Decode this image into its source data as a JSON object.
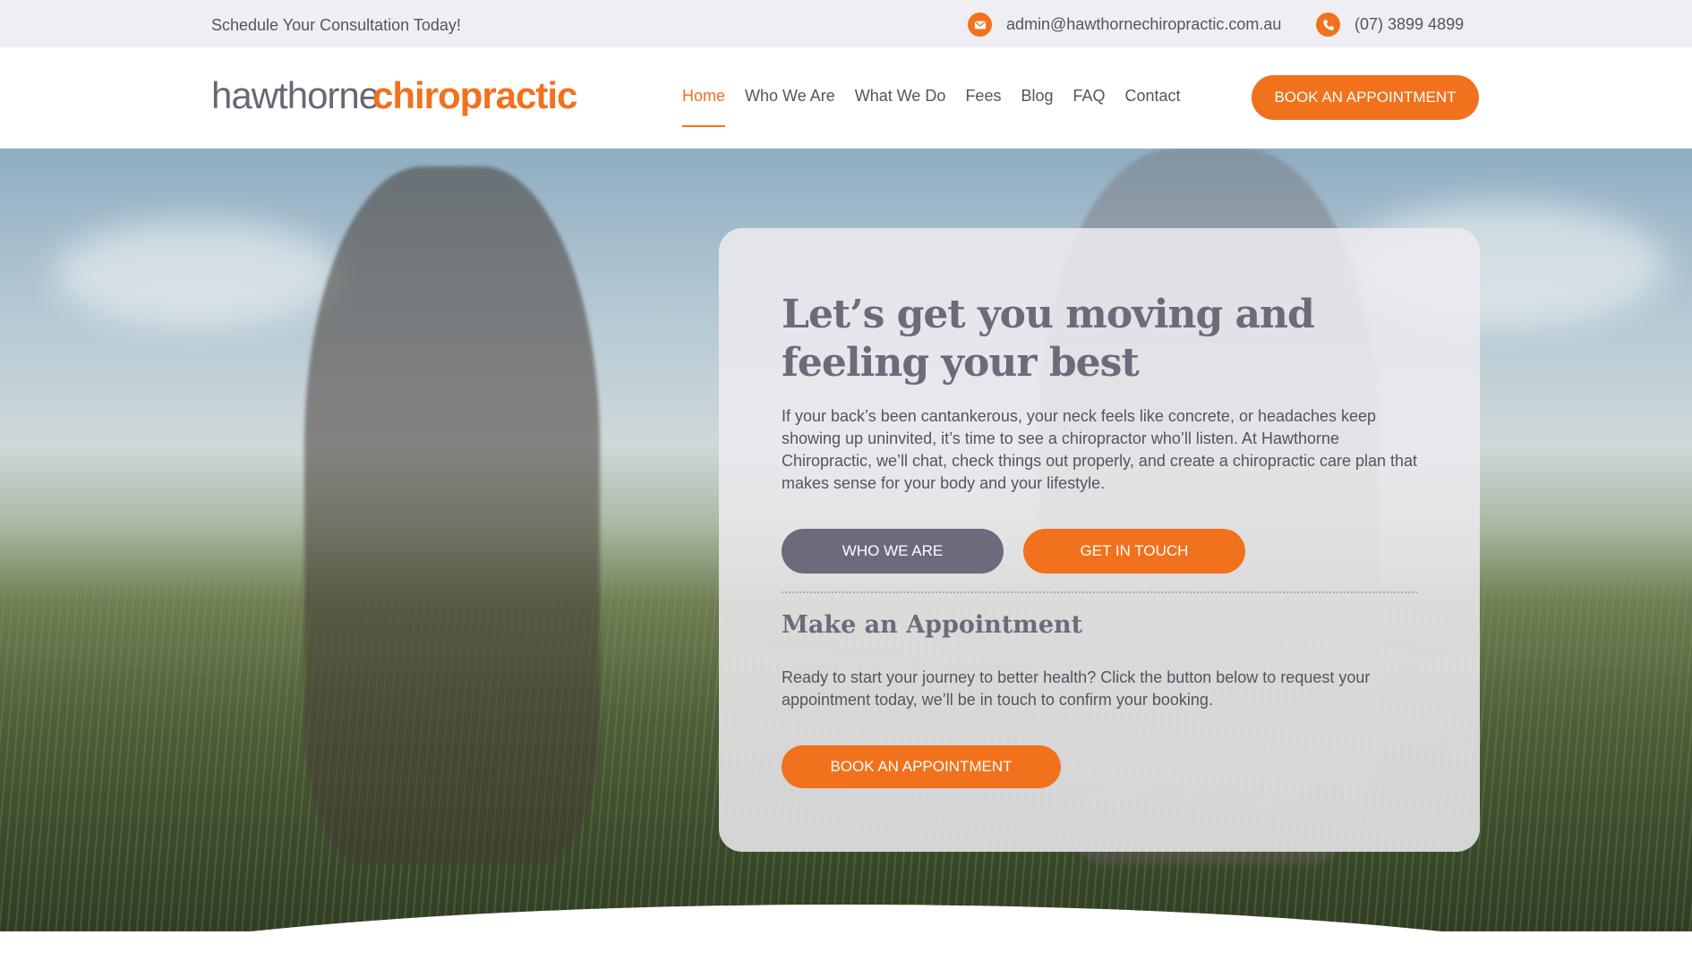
{
  "topbar": {
    "tagline": "Schedule Your Consultation Today!",
    "email": "admin@hawthornechiropractic.com.au",
    "phone": "(07) 3899 4899",
    "email_icon": "envelope-icon",
    "phone_icon": "phone-icon"
  },
  "logo": {
    "light": "hawthorne",
    "bold": "chiropractic"
  },
  "nav": {
    "items": [
      {
        "label": "Home",
        "active": true
      },
      {
        "label": "Who We Are"
      },
      {
        "label": "What We Do"
      },
      {
        "label": "Fees"
      },
      {
        "label": "Blog"
      },
      {
        "label": "FAQ"
      },
      {
        "label": "Contact"
      }
    ],
    "book_label": "BOOK AN APPOINTMENT"
  },
  "hero": {
    "title": "Let’s get you moving and feeling your best",
    "lead": "If your back’s been cantankerous, your neck feels like concrete, or headaches keep showing up uninvited, it’s time to see a chiropractor who’ll listen. At Hawthorne Chiropractic, we’ll chat, check things out properly, and create a chiropractic care plan that makes sense for your body and your lifestyle.",
    "who_label": "WHO WE ARE",
    "touch_label": "GET IN TOUCH",
    "appointment_title": "Make an Appointment",
    "appointment_text": "Ready to start your journey to better health? Click the button below to request your appointment today, we’ll be in touch to confirm your booking.",
    "book_label": "BOOK AN APPOINTMENT"
  },
  "colors": {
    "accent": "#f2711c",
    "secondary": "#6d6a7c",
    "topbar_bg": "#efeef2"
  }
}
